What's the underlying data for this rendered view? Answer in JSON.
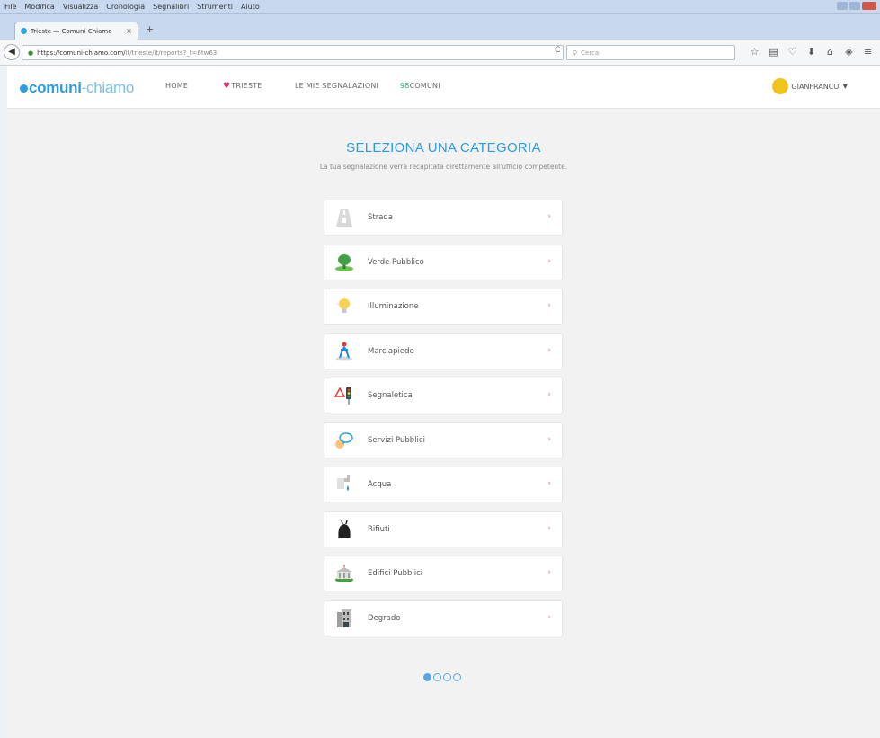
{
  "menubar": {
    "items": [
      "File",
      "Modifica",
      "Visualizza",
      "Cronologia",
      "Segnalibri",
      "Strumenti",
      "Aiuto"
    ]
  },
  "tab": {
    "title": "Trieste — Comuni-Chiamo",
    "close": "×",
    "new_tab": "+"
  },
  "nav": {
    "back": "◀",
    "url_host": "https://comuni-chiamo.com/",
    "url_path": "it/trieste/it/reports?_t=6tw63",
    "reload": "C",
    "search_placeholder": "Cerca",
    "toolbar_icons": [
      "star-icon",
      "reading-list-icon",
      "pocket-icon",
      "download-icon",
      "home-icon",
      "addon-icon",
      "menu-icon"
    ]
  },
  "site": {
    "logo_bold": "comuni",
    "logo_sep": "-",
    "logo_light": "chiamo",
    "nav_home": "HOME",
    "nav_city": "TRIESTE",
    "nav_reports": "LE MIE SEGNALAZIONI",
    "nav_count": "98",
    "nav_comuni": "COMUNI",
    "user_name": "GIANFRANCO"
  },
  "main": {
    "title": "SELEZIONA UNA CATEGORIA",
    "subtitle": "La tua segnalazione verrà recapitata direttamente all'ufficio competente.",
    "categories": [
      {
        "label": "Strada",
        "icon": "road-icon"
      },
      {
        "label": "Verde Pubblico",
        "icon": "tree-icon"
      },
      {
        "label": "Illuminazione",
        "icon": "lightbulb-icon"
      },
      {
        "label": "Marciapiede",
        "icon": "pedestrian-icon"
      },
      {
        "label": "Segnaletica",
        "icon": "traffic-light-icon"
      },
      {
        "label": "Servizi Pubblici",
        "icon": "speech-bubble-icon"
      },
      {
        "label": "Acqua",
        "icon": "water-tap-icon"
      },
      {
        "label": "Rifiuti",
        "icon": "trash-bag-icon"
      },
      {
        "label": "Edifici Pubblici",
        "icon": "building-icon"
      },
      {
        "label": "Degrado",
        "icon": "degraded-building-icon"
      }
    ],
    "pagination_active": 1,
    "pagination_total": 4
  },
  "colors": {
    "accent": "#2a9be4",
    "chevron": "#e07a8a",
    "heart": "#d6336c",
    "count": "#2aa876",
    "avatar": "#f2c31f"
  }
}
